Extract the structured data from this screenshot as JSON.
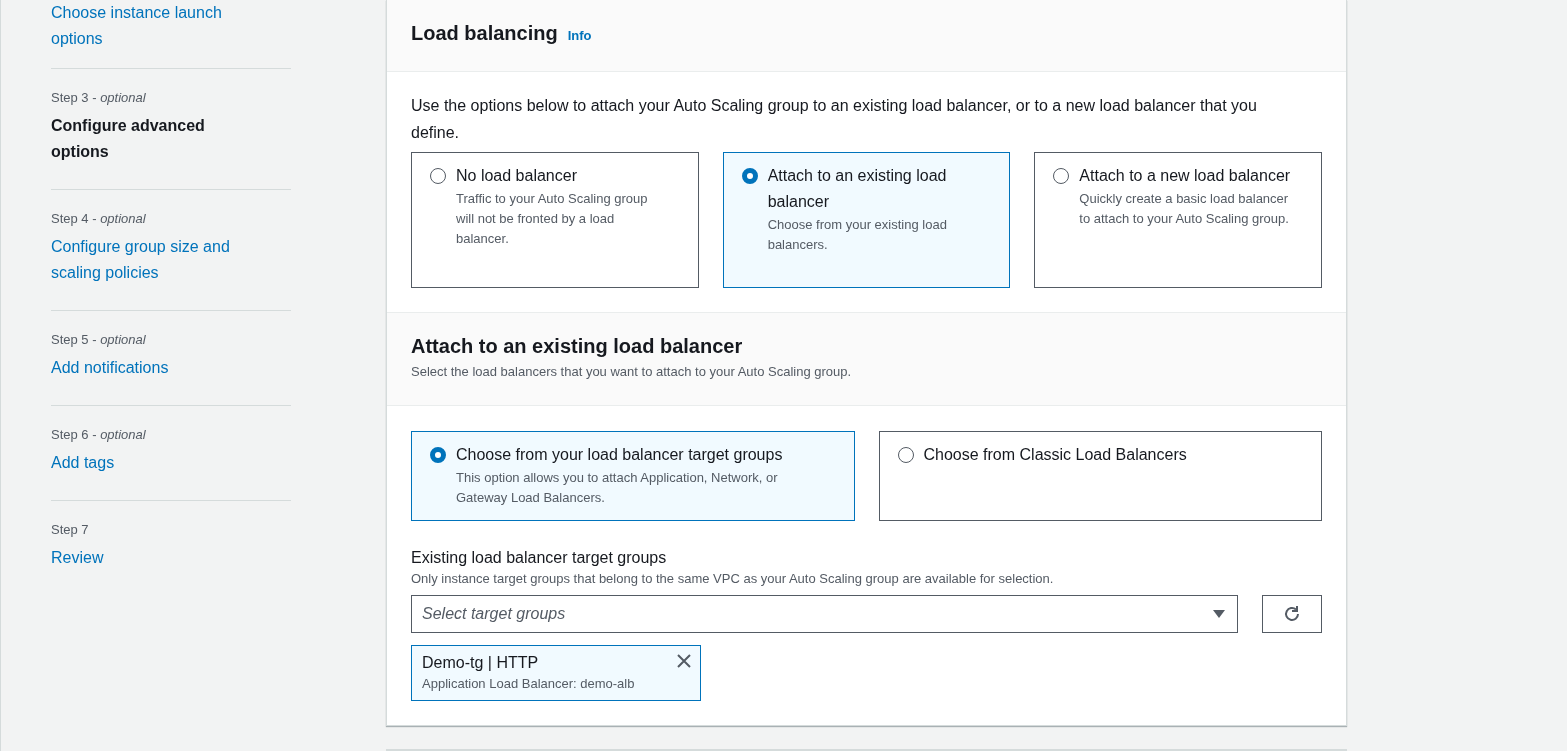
{
  "sidebar": {
    "steps": [
      {
        "title": "Choose instance launch options",
        "current": false
      },
      {
        "step_label": "Step 3 - *optional*",
        "title": "Configure advanced options",
        "current": true
      },
      {
        "step_label": "Step 4 - *optional*",
        "title": "Configure group size and scaling policies",
        "current": false
      },
      {
        "step_label": "Step 5 - *optional*",
        "title": "Add notifications",
        "current": false
      },
      {
        "step_label": "Step 6 - *optional*",
        "title": "Add tags",
        "current": false
      },
      {
        "step_label": "Step 7",
        "title": "Review",
        "current": false
      }
    ]
  },
  "load_balancing": {
    "title": "Load balancing",
    "info_link": "Info",
    "description": "Use the options below to attach your Auto Scaling group to an existing load balancer, or to a new load balancer that you define.",
    "options": [
      {
        "title": "No load balancer",
        "description": "Traffic to your Auto Scaling group will not be fronted by a load balancer.",
        "selected": false
      },
      {
        "title": "Attach to an existing load balancer",
        "description": "Choose from your existing load balancers.",
        "selected": true
      },
      {
        "title": "Attach to a new load balancer",
        "description": "Quickly create a basic load balancer to attach to your Auto Scaling group.",
        "selected": false
      }
    ]
  },
  "attach_section": {
    "title": "Attach to an existing load balancer",
    "subtitle": "Select the load balancers that you want to attach to your Auto Scaling group.",
    "source_options": [
      {
        "title": "Choose from your load balancer target groups",
        "description": "This option allows you to attach Application, Network, or Gateway Load Balancers.",
        "selected": true
      },
      {
        "title": "Choose from Classic Load Balancers",
        "selected": false
      }
    ],
    "target_groups": {
      "label": "Existing load balancer target groups",
      "hint": "Only instance target groups that belong to the same VPC as your Auto Scaling group are available for selection.",
      "placeholder": "Select target groups",
      "tokens": [
        {
          "title": "Demo-tg | HTTP",
          "subtitle": "Application Load Balancer: demo-alb"
        }
      ]
    }
  }
}
